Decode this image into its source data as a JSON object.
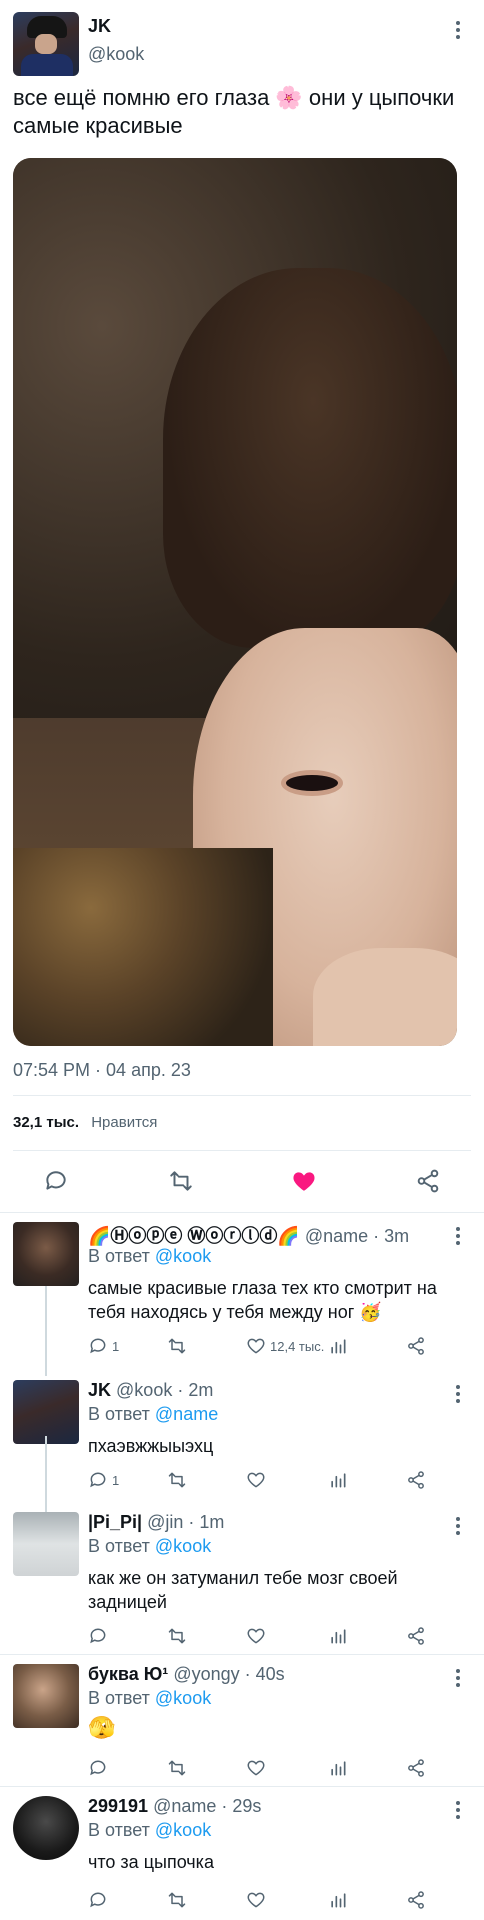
{
  "main_tweet": {
    "author_name": "JK",
    "author_handle": "@kook",
    "text": "все ещё помню его глаза 🌸 они  у цыпочки самые красивые",
    "timestamp": "07:54 PM · 04 апр. 23",
    "likes_count": "32,1 тыс.",
    "likes_label": "Нравится",
    "liked": true,
    "like_color": "#f91880",
    "icons": [
      "reply-icon",
      "retweet-icon",
      "heart-filled-icon",
      "share-icon"
    ]
  },
  "replies": [
    {
      "name": "🌈Ⓗⓞⓟⓔ Ⓦⓞⓡⓛⓓ🌈",
      "meta": "@name · 3m",
      "reply_prefix": "В ответ",
      "reply_to": "@kook",
      "text": "самые красивые глаза тех кто смотрит на тебя  находясь у тебя между ног 🥳",
      "reply_count": "1",
      "retweet_count": "",
      "like_count": "12,4 тыс."
    },
    {
      "name": "JK",
      "meta": "@kook · 2m",
      "reply_prefix": "В ответ",
      "reply_to": "@name",
      "text": "пхаэвжжыыэхц",
      "reply_count": "1",
      "retweet_count": "",
      "like_count": ""
    },
    {
      "name": "|Pi_Pi|",
      "meta": "@jin · 1m",
      "reply_prefix": "В ответ",
      "reply_to": "@kook",
      "text": "как же он затуманил  тебе мозг своей задницей",
      "reply_count": "",
      "retweet_count": "",
      "like_count": ""
    },
    {
      "name": "буква Ю¹",
      "meta": "@yongy · 40s",
      "reply_prefix": "В ответ",
      "reply_to": "@kook",
      "text": "🫣",
      "reply_count": "",
      "retweet_count": "",
      "like_count": ""
    },
    {
      "name": "299191",
      "meta": "@name · 29s",
      "reply_prefix": "В ответ",
      "reply_to": "@kook",
      "text": "что за цыпочка",
      "reply_count": "",
      "retweet_count": "",
      "like_count": ""
    }
  ]
}
